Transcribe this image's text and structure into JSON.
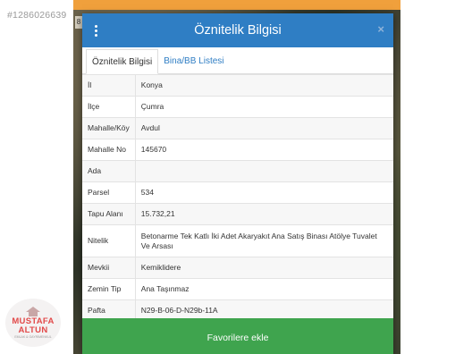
{
  "watermark": "#1286026639",
  "logo": {
    "line1": "MUSTAFA",
    "line2": "ALTUN",
    "line3": "EMLAK & GAYRİMENKUL"
  },
  "map": {
    "tag": "8"
  },
  "modal": {
    "title": "Öznitelik Bilgisi",
    "close_label": "×",
    "tabs": [
      {
        "label": "Öznitelik Bilgisi",
        "active": true
      },
      {
        "label": "Bina/BB Listesi",
        "active": false
      }
    ],
    "rows": [
      {
        "key": "İl",
        "value": "Konya"
      },
      {
        "key": "İlçe",
        "value": "Çumra"
      },
      {
        "key": "Mahalle/Köy",
        "value": "Avdul"
      },
      {
        "key": "Mahalle No",
        "value": "145670"
      },
      {
        "key": "Ada",
        "value": ""
      },
      {
        "key": "Parsel",
        "value": "534"
      },
      {
        "key": "Tapu Alanı",
        "value": "15.732,21"
      },
      {
        "key": "Nitelik",
        "value": "Betonarme Tek Katlı İki Adet Akaryakıt Ana Satış Binası Atölye Tuvalet Ve Arsası"
      },
      {
        "key": "Mevkii",
        "value": "Kemiklidere"
      },
      {
        "key": "Zemin Tip",
        "value": "Ana Taşınmaz"
      },
      {
        "key": "Pafta",
        "value": "N29-B-06-D-N29b-11A"
      }
    ],
    "button_label": "Favorilere ekle"
  },
  "colors": {
    "header": "#2f7ec4",
    "button": "#3fa44e",
    "accent_strip": "#f0a03c"
  }
}
